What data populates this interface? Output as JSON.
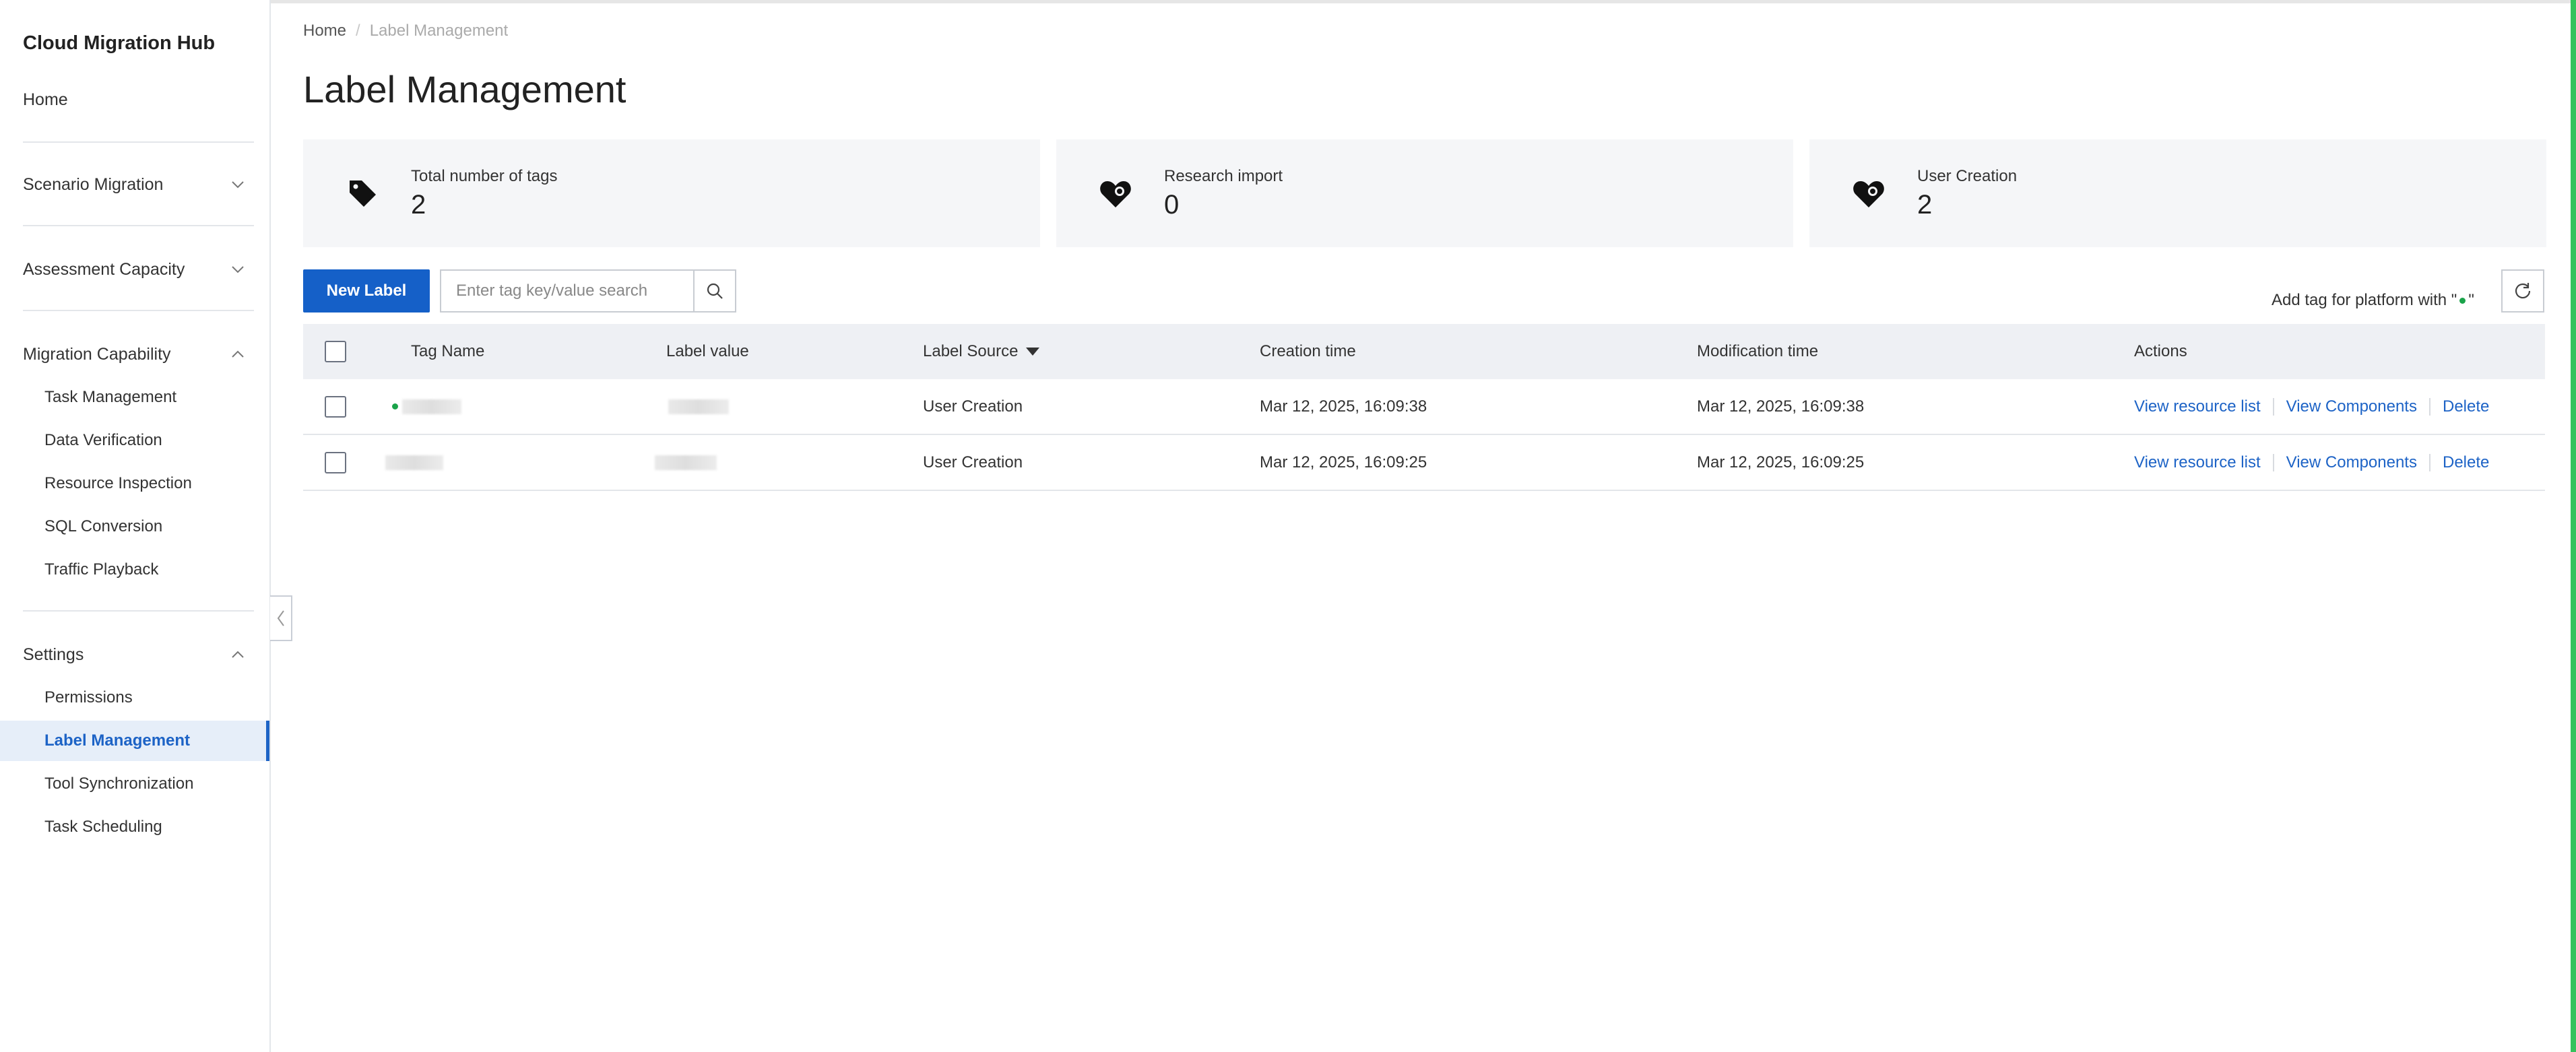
{
  "sidebar": {
    "brand": "Cloud Migration Hub",
    "home": "Home",
    "groups": [
      {
        "label": "Scenario Migration",
        "expanded": false
      },
      {
        "label": "Assessment Capacity",
        "expanded": false
      },
      {
        "label": "Migration Capability",
        "expanded": true,
        "items": [
          "Task Management",
          "Data Verification",
          "Resource Inspection",
          "SQL Conversion",
          "Traffic Playback"
        ]
      },
      {
        "label": "Settings",
        "expanded": true,
        "items": [
          "Permissions",
          "Label Management",
          "Tool Synchronization",
          "Task Scheduling"
        ],
        "active": "Label Management"
      }
    ]
  },
  "breadcrumb": {
    "home": "Home",
    "separator": "/",
    "current": "Label Management"
  },
  "page_title": "Label Management",
  "stats": [
    {
      "label": "Total number of tags",
      "value": "2",
      "icon": "tag-icon"
    },
    {
      "label": "Research import",
      "value": "0",
      "icon": "heart-tag-import-icon"
    },
    {
      "label": "User Creation",
      "value": "2",
      "icon": "heart-tag-user-icon"
    }
  ],
  "toolbar": {
    "new_label": "New Label",
    "search_placeholder": "Enter tag key/value search",
    "platform_note_prefix": "Add tag for platform with \"",
    "platform_note_suffix": "\""
  },
  "table": {
    "columns": [
      "Tag Name",
      "Label value",
      "Label Source",
      "Creation time",
      "Modification time",
      "Actions"
    ],
    "rows": [
      {
        "source": "User Creation",
        "created": "Mar 12, 2025, 16:09:38",
        "modified": "Mar 12, 2025, 16:09:38",
        "has_dot": true
      },
      {
        "source": "User Creation",
        "created": "Mar 12, 2025, 16:09:25",
        "modified": "Mar 12, 2025, 16:09:25",
        "has_dot": false
      }
    ],
    "actions": [
      "View resource list",
      "View Components",
      "Delete"
    ]
  },
  "colors": {
    "primary": "#1560c8",
    "link": "#1d63c6",
    "active_bg": "#e6eef9",
    "edge": "#36c25c",
    "dot": "#1aa34a"
  }
}
